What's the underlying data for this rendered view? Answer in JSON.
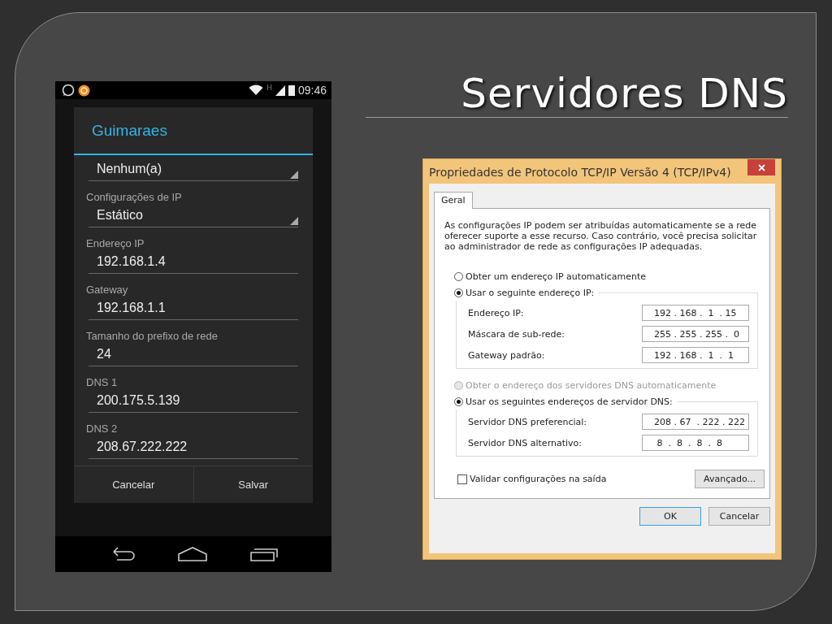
{
  "slide_title": "Servidores DNS",
  "phone": {
    "status_bar": {
      "network_type": "H",
      "time": "09:46"
    },
    "dialog": {
      "title": "Guimaraes",
      "fields": [
        {
          "kind": "dropdown",
          "value": "Nenhum(a)"
        },
        {
          "kind": "dropdown",
          "label": "Configurações de IP",
          "value": "Estático"
        },
        {
          "kind": "text",
          "label": "Endereço IP",
          "value": "192.168.1.4"
        },
        {
          "kind": "text",
          "label": "Gateway",
          "value": "192.168.1.1"
        },
        {
          "kind": "text",
          "label": "Tamanho do prefixo de rede",
          "value": "24"
        },
        {
          "kind": "text",
          "label": "DNS 1",
          "value": "200.175.5.139"
        },
        {
          "kind": "text",
          "label": "DNS 2",
          "value": "208.67.222.222"
        }
      ],
      "buttons": [
        "Cancelar",
        "Salvar"
      ]
    }
  },
  "window": {
    "title": "Propriedades de Protocolo TCP/IP Versão 4 (TCP/IPv4)",
    "tabs": [
      {
        "label": "Geral",
        "selected": true
      }
    ],
    "intro": "As configurações IP podem ser atribuídas automaticamente se a rede oferecer suporte a esse recurso. Caso contrário, você precisa solicitar ao administrador de rede as configurações IP adequadas.",
    "radio_options": [
      {
        "label": "Obter um endereço IP automaticamente",
        "selected": false,
        "disabled": false
      },
      {
        "label": "Usar o seguinte endereço IP:",
        "selected": true,
        "disabled": false,
        "fields": [
          {
            "label": "Endereço IP:",
            "value": "192 . 168 .  1  . 15"
          },
          {
            "label": "Máscara de sub-rede:",
            "value": "255 . 255 . 255 .  0"
          },
          {
            "label": "Gateway padrão:",
            "value": "192 . 168 .  1  .  1"
          }
        ]
      },
      {
        "label": "Obter o endereço dos servidores DNS automaticamente",
        "selected": false,
        "disabled": true
      },
      {
        "label": "Usar os seguintes endereços de servidor DNS:",
        "selected": true,
        "disabled": false,
        "fields": [
          {
            "label": "Servidor DNS preferencial:",
            "value": "208 . 67  . 222 . 222"
          },
          {
            "label": "Servidor DNS alternativo:",
            "value": " 8  .  8  .  8  .  8"
          }
        ]
      }
    ],
    "checkbox": {
      "label": "Validar configurações na saída",
      "checked": false
    },
    "advanced_button": "Avançado...",
    "buttons": [
      {
        "label": "OK",
        "default": true
      },
      {
        "label": "Cancelar",
        "default": false
      }
    ]
  }
}
